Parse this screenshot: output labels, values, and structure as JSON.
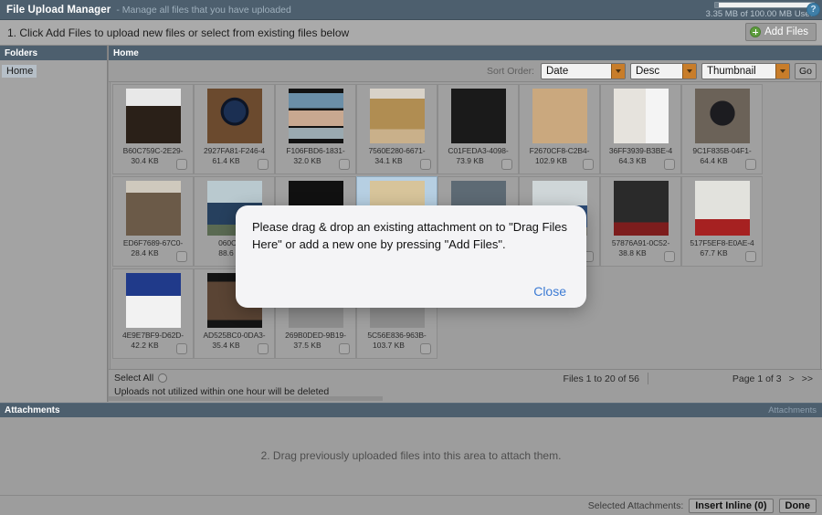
{
  "titlebar": {
    "title": "File Upload Manager",
    "subtitle": "- Manage all files that you have uploaded",
    "quota_text": "3.35 MB of 100.00 MB Used",
    "help_glyph": "?"
  },
  "step1": {
    "instruction": "1. Click Add Files to upload new files or select from existing files below",
    "add_files_label": "Add Files"
  },
  "folders": {
    "header": "Folders",
    "items": [
      {
        "label": "Home"
      }
    ]
  },
  "filespane": {
    "header": "Home",
    "sort": {
      "label": "Sort Order:",
      "field_value": "Date",
      "direction_value": "Desc",
      "view_value": "Thumbnail",
      "go_label": "Go"
    },
    "files": [
      {
        "name": "B60C759C-2E29-",
        "size": "30.4 KB",
        "selected": false,
        "thumb": "meme-caption-dark"
      },
      {
        "name": "2927FA81-F246-4",
        "size": "61.4 KB",
        "selected": false,
        "thumb": "blue-dial-watch"
      },
      {
        "name": "F106FBD6-1831-",
        "size": "32.0 KB",
        "selected": false,
        "thumb": "video-call-grid"
      },
      {
        "name": "7560E280-6671-",
        "size": "34.1 KB",
        "selected": false,
        "thumb": "hand-holding-bottle"
      },
      {
        "name": "C01FEDA3-4098-",
        "size": "73.9 KB",
        "selected": false,
        "thumb": "merry-christmas-poster"
      },
      {
        "name": "F2670CF8-C2B4-",
        "size": "102.9 KB",
        "selected": false,
        "thumb": "handgun-photo"
      },
      {
        "name": "36FF3939-B3BE-4",
        "size": "64.3 KB",
        "selected": false,
        "thumb": "document-screenshot"
      },
      {
        "name": "9C1F835B-04F1-",
        "size": "64.4 KB",
        "selected": false,
        "thumb": "chronograph-watch"
      },
      {
        "name": "ED6F7689-67C0-",
        "size": "28.4 KB",
        "selected": false,
        "thumb": "person-with-revolver"
      },
      {
        "name": "060C81B",
        "size": "88.6",
        "selected": false,
        "thumb": "blue-convertible-car"
      },
      {
        "name": "",
        "size": "",
        "selected": false,
        "thumb": "black-text-meme"
      },
      {
        "name": "",
        "size": "",
        "selected": true,
        "thumb": "revolver-on-blue"
      },
      {
        "name": "",
        "size": "",
        "selected": false,
        "thumb": "military-vehicle"
      },
      {
        "name": "",
        "size": "",
        "selected": false,
        "thumb": "blue-sedan-car"
      },
      {
        "name": "57876A91-0C52-",
        "size": "38.8 KB",
        "selected": false,
        "thumb": "historic-bw-photo"
      },
      {
        "name": "517F5EF8-E0AE-4",
        "size": "67.7 KB",
        "selected": false,
        "thumb": "crowd-rally-photo"
      },
      {
        "name": "4E9E7BF9-D62D-",
        "size": "42.2 KB",
        "selected": false,
        "thumb": "any-functioning-adult-2020"
      },
      {
        "name": "AD525BC0-0DA3-",
        "size": "35.4 KB",
        "selected": false,
        "thumb": "dark-portrait-meme"
      },
      {
        "name": "269B0DED-9B19-",
        "size": "37.5 KB",
        "selected": false,
        "thumb": "placeholder-grey"
      },
      {
        "name": "5C56E836-963B-",
        "size": "103.7 KB",
        "selected": false,
        "thumb": "placeholder-grey"
      }
    ],
    "footer": {
      "select_all_label": "Select All",
      "file_range": "Files 1 to 20 of 56",
      "page_label": "Page 1 of 3",
      "next_page": ">",
      "last_page": ">>",
      "warning": "Uploads not utilized within one hour will be deleted"
    }
  },
  "attachments": {
    "header_left": "Attachments",
    "header_right": "Attachments",
    "dropzone_text": "2. Drag previously uploaded files into this area to attach them.",
    "footer_label": "Selected Attachments:",
    "insert_inline_label": "Insert Inline (0)",
    "done_label": "Done"
  },
  "modal": {
    "message": "Please drag & drop an existing attachment on to \"Drag Files Here\" or add a new one by pressing \"Add Files\".",
    "close_label": "Close"
  },
  "colors": {
    "chrome": "#4d5f6e",
    "body": "#9d9d9d",
    "accent_orange": "#c87d2a",
    "link_blue": "#3d7bd4",
    "selection_blue": "#b6cfe2"
  }
}
